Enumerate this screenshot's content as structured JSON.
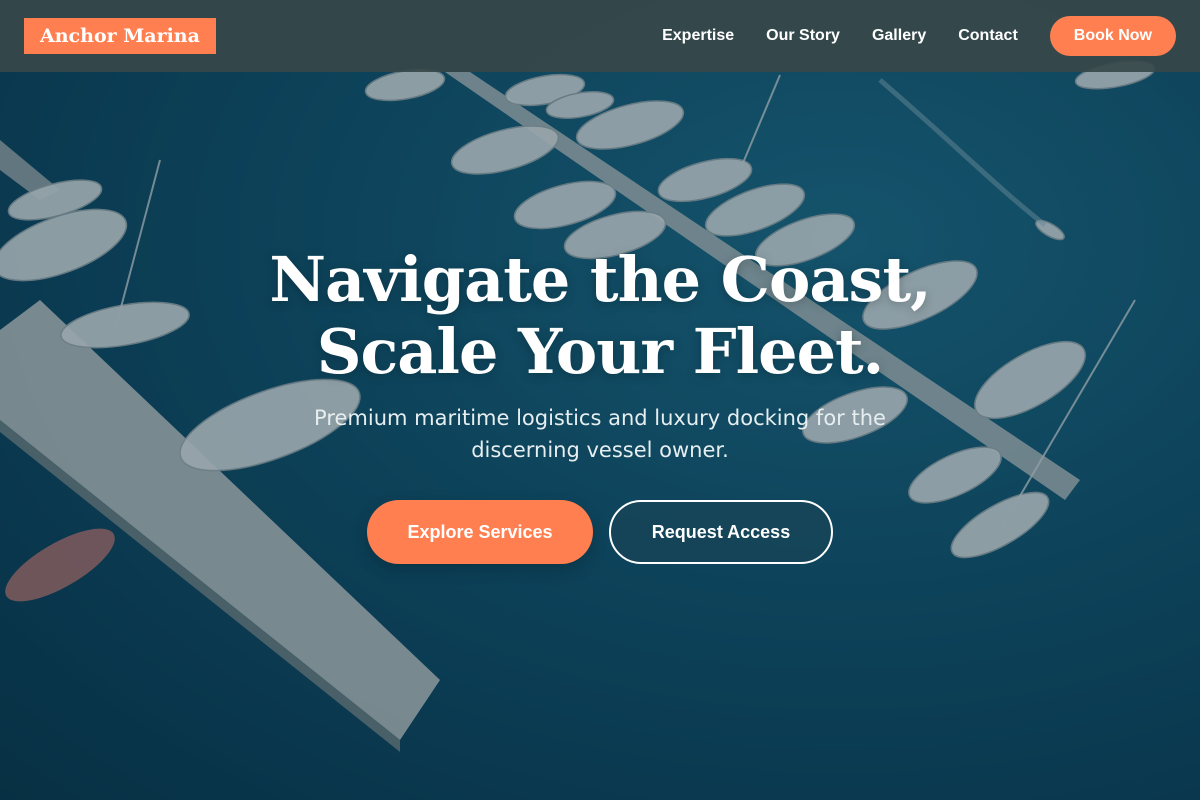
{
  "brand": {
    "name": "Anchor Marina",
    "accent_color": "#ff7f50"
  },
  "nav": {
    "links": [
      "Expertise",
      "Our Story",
      "Gallery",
      "Contact"
    ],
    "cta_label": "Book Now"
  },
  "hero": {
    "title_line_1": "Navigate the Coast,",
    "title_line_2": "Scale Your Fleet.",
    "subtitle": "Premium maritime logistics and luxury docking for the discerning vessel owner.",
    "primary_button": "Explore Services",
    "secondary_button": "Request Access",
    "background_image": "aerial-marina-photo"
  }
}
